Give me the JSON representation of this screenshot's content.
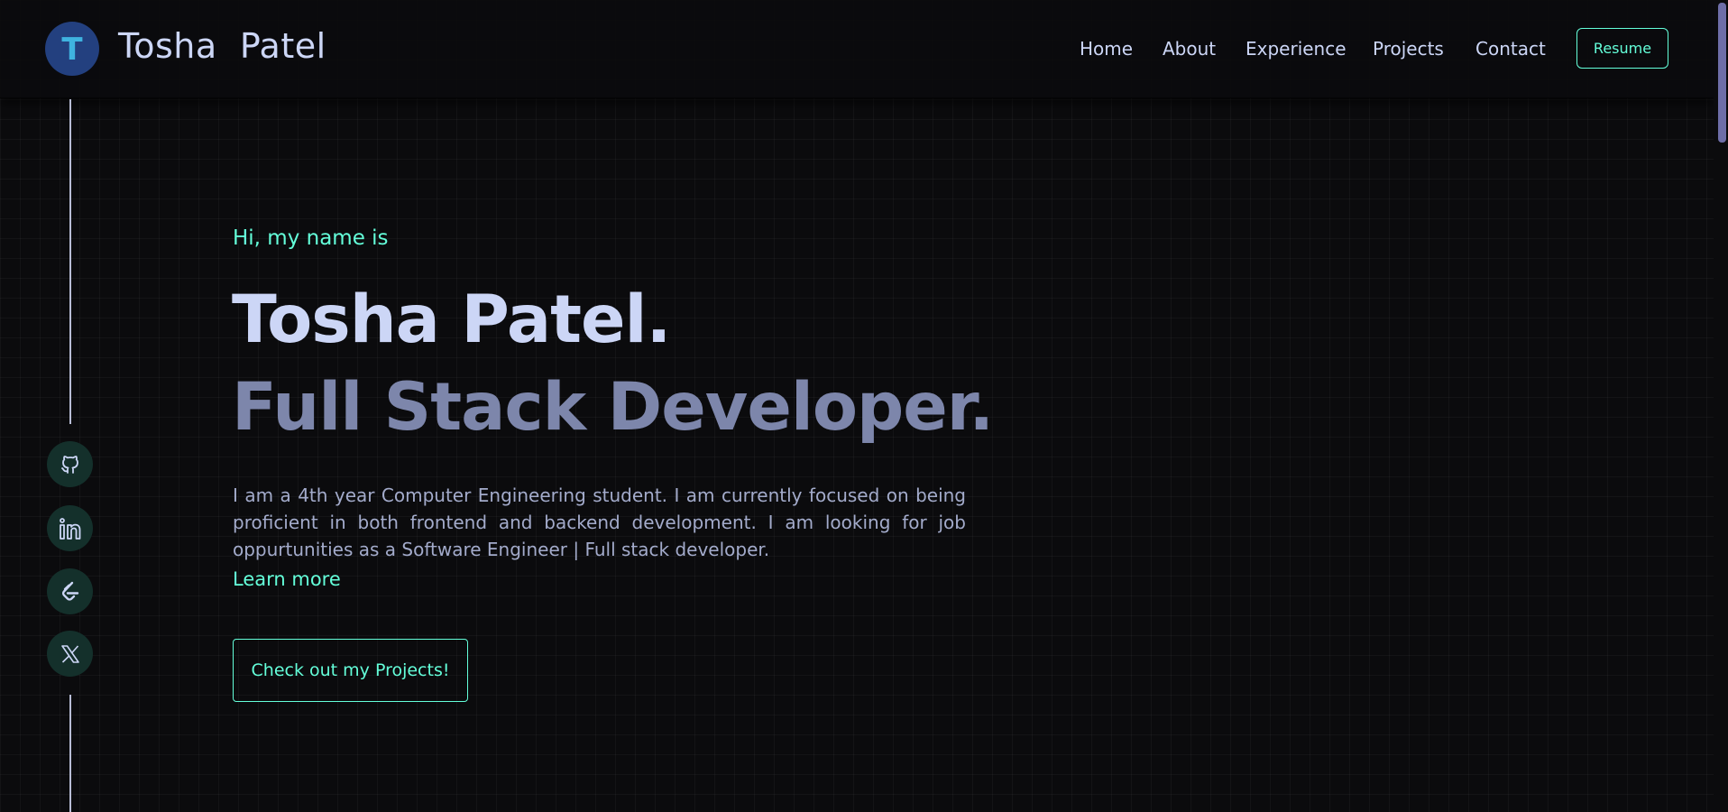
{
  "header": {
    "logo_letter": "T",
    "brand_name": "Tosha  Patel",
    "nav": [
      "Home",
      "About",
      "Experience",
      "Projects",
      "Contact"
    ],
    "resume_label": "Resume"
  },
  "socials": [
    {
      "icon": "github-icon"
    },
    {
      "icon": "linkedin-icon"
    },
    {
      "icon": "leetcode-icon"
    },
    {
      "icon": "x-twitter-icon"
    }
  ],
  "hero": {
    "greeting": "Hi, my name is",
    "name": "Tosha Patel.",
    "role": "Full Stack Developer.",
    "bio": "I am a 4th year Computer Engineering student. I am currently focused on being proficient in both frontend and backend development. I am looking for job oppurtunities as a Software Engineer | Full stack developer.",
    "learn_more": "Learn more",
    "cta_label": "Check out my Projects!"
  },
  "colors": {
    "accent": "#64ffda",
    "background": "#0b0b0d",
    "text_primary": "#ccd6f6",
    "text_secondary": "#7d86ab",
    "logo_bg": "#23407f"
  }
}
